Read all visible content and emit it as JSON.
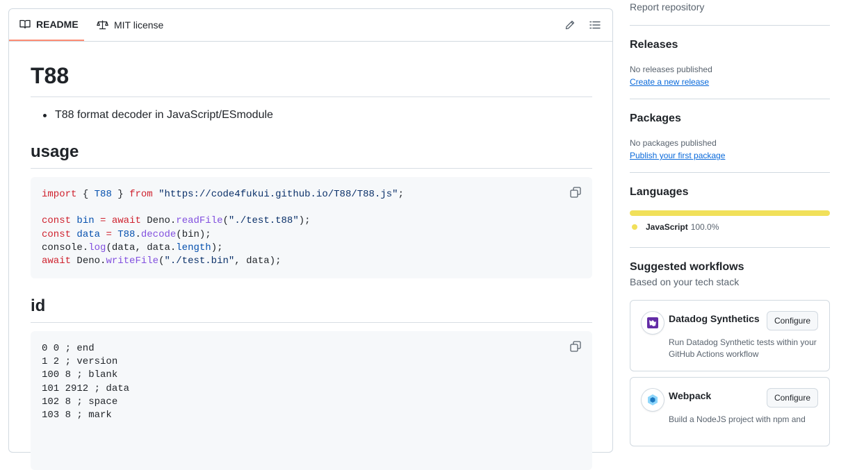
{
  "tabs": [
    {
      "label": "README",
      "icon": "book-icon",
      "active": true
    },
    {
      "label": "MIT license",
      "icon": "scale-icon",
      "active": false
    }
  ],
  "readme": {
    "title": "T88",
    "bullet": "T88 format decoder in JavaScript/ESmodule",
    "usage_heading": "usage",
    "id_heading": "id",
    "id_lines": [
      "0 0 ; end",
      "1 2 ; version",
      "100 8 ; blank",
      "101 2912 ; data",
      "102 8 ; space",
      "103 8 ; mark"
    ]
  },
  "sidebar": {
    "report": "Report repository",
    "releases": {
      "title": "Releases",
      "status": "No releases published",
      "link": "Create a new release"
    },
    "packages": {
      "title": "Packages",
      "status": "No packages published",
      "link": "Publish your first package"
    },
    "languages": {
      "title": "Languages",
      "name": "JavaScript",
      "percent": "100.0%",
      "color": "#f1e05a",
      "share": 100
    },
    "workflows": {
      "title": "Suggested workflows",
      "subtitle": "Based on your tech stack",
      "items": [
        {
          "name": "Datadog Synthetics",
          "button": "Configure",
          "desc": "Run Datadog Synthetic tests within your GitHub Actions workflow"
        },
        {
          "name": "Webpack",
          "button": "Configure",
          "desc": "Build a NodeJS project with npm and"
        }
      ]
    }
  },
  "colors": {
    "accent": "#0969da",
    "tab_underline": "#fd8c73",
    "keyword": "#cf222e",
    "string": "#0a3069",
    "function": "#8250df"
  }
}
